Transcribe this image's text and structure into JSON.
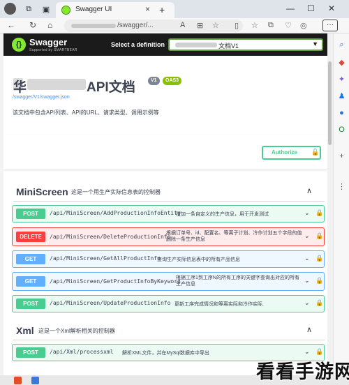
{
  "browser": {
    "tab_title": "Swagger UI",
    "tab_close": "×",
    "new_tab": "+",
    "url_text": "/swagger/...",
    "window_controls": [
      "—",
      "☐",
      "✕"
    ],
    "more_label": "···"
  },
  "header": {
    "logo_letter": "{}",
    "logo_text": "Swagger",
    "logo_sub": "Supported by SMARTBEAR",
    "definition_label": "Select a definition",
    "definition_value": "文档V1",
    "caret": "▼"
  },
  "info": {
    "title_prefix": "华",
    "title_main": "API文档",
    "version_badge": "V1",
    "oas_badge": "OAS3",
    "url": "/swagger/V1/swagger.json",
    "description": "该文档中包含API列表、API的URL、请求类型、调用示例等"
  },
  "authorize": {
    "label": "Authorize",
    "lock": "🔓"
  },
  "tags": [
    {
      "name": "MiniScreen",
      "description": "这是一个用生产实际信息表的控制器",
      "chevron": "∧",
      "operations": [
        {
          "method": "POST",
          "path": "/api/MiniScreen/AddProductionInfoEntity",
          "summary": "增加一条自定义的生产信息，用于开发测试"
        },
        {
          "method": "DELETE",
          "path": "/api/MiniScreen/DeleteProductionInfo",
          "summary": "根据订单号、id、配置名、等离子计划、冷作计划五个字段的值删除一条生产信息"
        },
        {
          "method": "GET",
          "path": "/api/MiniScreen/GetAllProductInfo",
          "summary": "查询生产实际信息表中的所有产品信息"
        },
        {
          "method": "GET",
          "path": "/api/MiniScreen/GetProductInfoByKeyword",
          "summary": "根据工序1到工序N的所有工序的关键字查询出对应的所有生产信息"
        },
        {
          "method": "POST",
          "path": "/api/MiniScreen/UpdateProductionInfo",
          "summary": "更新工序完成情况和等离实际和冷作实际."
        }
      ]
    },
    {
      "name": "Xml",
      "description": "这是一个Xml解析相关的控制器",
      "chevron": "∧",
      "operations": [
        {
          "method": "POST",
          "path": "/api/Xml/processxml",
          "summary": "解析XML文件，并在MySql数据库中导出"
        }
      ]
    }
  ],
  "icons": {
    "op_chevron": "⌄",
    "op_lock": "🔒"
  },
  "watermark": "看看手游网",
  "colors": {
    "post": "#49cc90",
    "delete": "#f93e3e",
    "get": "#61affe",
    "swagger_green": "#85ea2d",
    "topbar": "#1b1b1b"
  }
}
